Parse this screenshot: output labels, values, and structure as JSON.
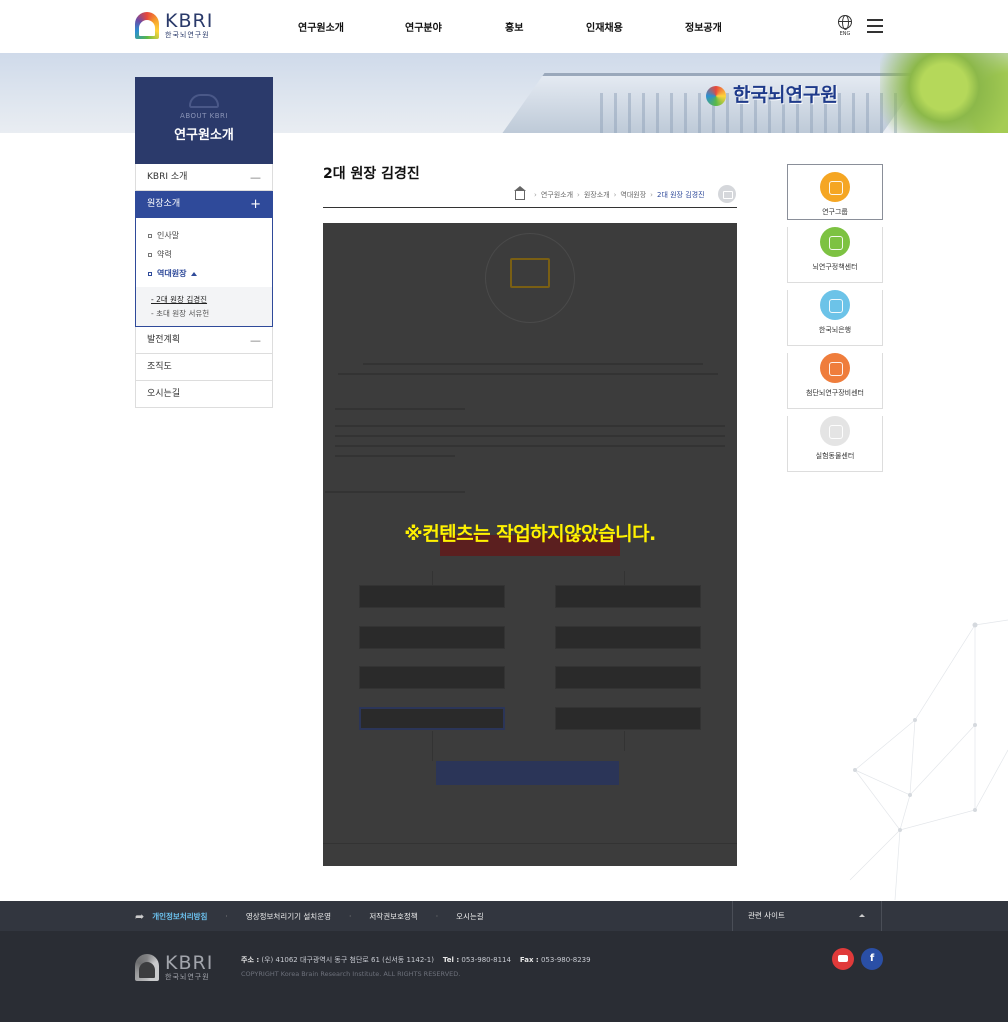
{
  "header": {
    "logo_en": "KBRI",
    "logo_ko": "한국뇌연구원",
    "nav": [
      "연구원소개",
      "연구분야",
      "홍보",
      "인재채용",
      "정보공개"
    ],
    "lang_label": "ENG"
  },
  "banner": {
    "sign_text": "한국뇌연구원"
  },
  "lnb": {
    "about": "ABOUT KBRI",
    "title": "연구원소개",
    "items": [
      {
        "label": "KBRI 소개",
        "sign": "—"
      },
      {
        "label": "원장소개",
        "sign": "+"
      },
      {
        "label": "발전계획",
        "sign": "—"
      },
      {
        "label": "조직도"
      },
      {
        "label": "오시는길"
      }
    ],
    "sub_items": [
      "인사말",
      "약력",
      "역대원장"
    ],
    "depth3": [
      "- 2대 원장 김경진",
      "- 초대 원장 서유헌"
    ]
  },
  "content": {
    "page_title": "2대 원장 김경진",
    "breadcrumb": [
      "연구원소개",
      "원장소개",
      "역대원장",
      "2대 원장 김경진"
    ],
    "notice": "※컨텐츠는 작업하지않았습니다."
  },
  "quick_menu": [
    {
      "label": "연구그룹",
      "color": "#f5a623"
    },
    {
      "label": "뇌연구정책센터",
      "color": "#7dc242"
    },
    {
      "label": "한국뇌은행",
      "color": "#6cc3e8"
    },
    {
      "label": "첨단뇌연구장비센터",
      "color": "#ef7d3c"
    },
    {
      "label": "실험동물센터",
      "color": "#e4e4e4"
    }
  ],
  "footer": {
    "links": [
      "개인정보처리방침",
      "영상정보처리기기 설치운영",
      "저작권보호정책",
      "오시는길"
    ],
    "related": "관련 사이트",
    "logo_en": "KBRI",
    "logo_ko": "한국뇌연구원",
    "address_label": "주소 :",
    "address": "(우) 41062 대구광역시 동구 첨단로 61 (신서동 1142-1)",
    "tel_label": "Tel :",
    "tel": "053-980-8114",
    "fax_label": "Fax :",
    "fax": "053-980-8239",
    "copyright": "COPYRIGHT  Korea Brain Research Institute. ALL RIGHTS RESERVED.",
    "sns": [
      "youtube-icon",
      "facebook-icon"
    ]
  }
}
